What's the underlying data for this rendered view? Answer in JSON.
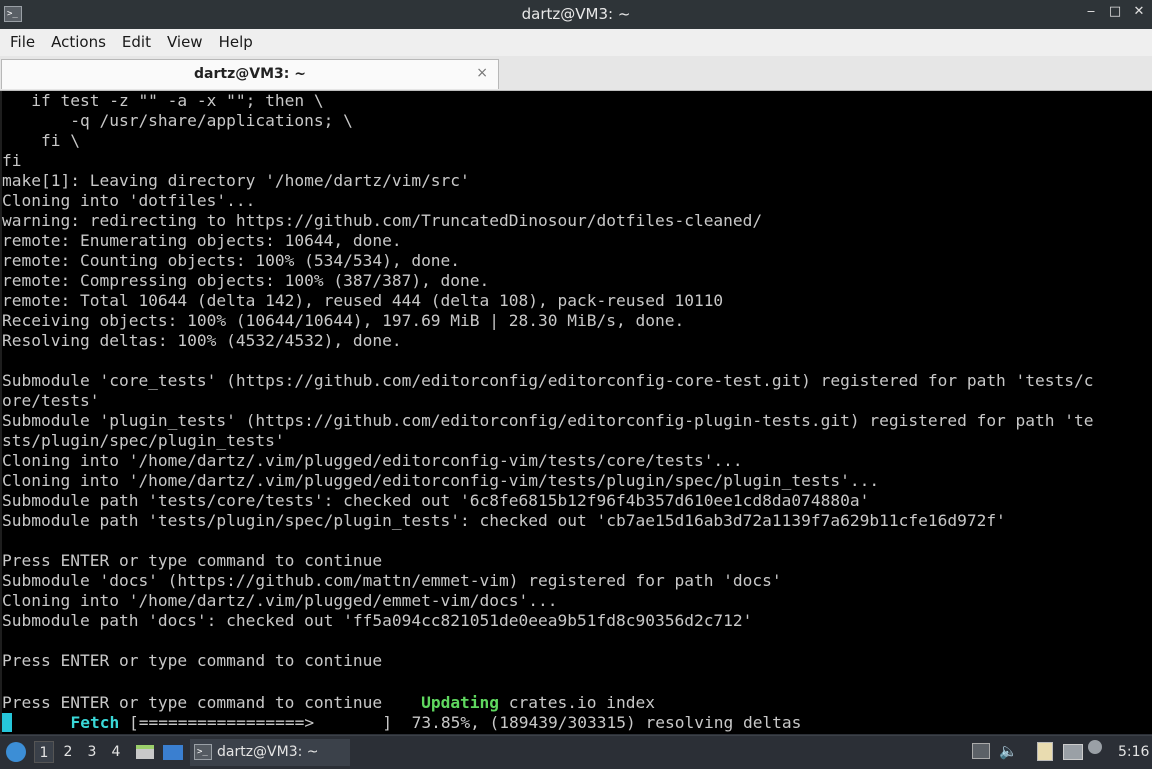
{
  "window": {
    "title": "dartz@VM3: ~",
    "icon_glyph": ">_",
    "controls": {
      "minimize": "‒",
      "maximize": "□",
      "close": "✕"
    }
  },
  "menu": [
    "File",
    "Actions",
    "Edit",
    "View",
    "Help"
  ],
  "tab": {
    "label": "dartz@VM3: ~",
    "close": "×"
  },
  "terminal": {
    "lines": [
      "   if test -z \"\" -a -x \"\"; then \\",
      "       -q /usr/share/applications; \\",
      "    fi \\",
      "fi",
      "make[1]: Leaving directory '/home/dartz/vim/src'",
      "Cloning into 'dotfiles'...",
      "warning: redirecting to https://github.com/TruncatedDinosour/dotfiles-cleaned/",
      "remote: Enumerating objects: 10644, done.",
      "remote: Counting objects: 100% (534/534), done.",
      "remote: Compressing objects: 100% (387/387), done.",
      "remote: Total 10644 (delta 142), reused 444 (delta 108), pack-reused 10110",
      "Receiving objects: 100% (10644/10644), 197.69 MiB | 28.30 MiB/s, done.",
      "Resolving deltas: 100% (4532/4532), done.",
      "",
      "Submodule 'core_tests' (https://github.com/editorconfig/editorconfig-core-test.git) registered for path 'tests/c",
      "ore/tests'",
      "Submodule 'plugin_tests' (https://github.com/editorconfig/editorconfig-plugin-tests.git) registered for path 'te",
      "sts/plugin/spec/plugin_tests'",
      "Cloning into '/home/dartz/.vim/plugged/editorconfig-vim/tests/core/tests'...",
      "Cloning into '/home/dartz/.vim/plugged/editorconfig-vim/tests/plugin/spec/plugin_tests'...",
      "Submodule path 'tests/core/tests': checked out '6c8fe6815b12f96f4b357d610ee1cd8da074880a'",
      "Submodule path 'tests/plugin/spec/plugin_tests': checked out 'cb7ae15d16ab3d72a1139f7a629b11cfe16d972f'",
      "",
      "Press ENTER or type command to continue",
      "Submodule 'docs' (https://github.com/mattn/emmet-vim) registered for path 'docs'",
      "Cloning into '/home/dartz/.vim/plugged/emmet-vim/docs'...",
      "Submodule path 'docs': checked out 'ff5a094cc821051de0eea9b51fd8c90356d2c712'",
      "",
      "Press ENTER or type command to continue",
      ""
    ],
    "press_line": {
      "prefix": "Press ENTER or type command to continue    ",
      "updating": "Updating",
      "suffix": " crates.io index"
    },
    "fetch_line": {
      "indent": "      ",
      "fetch": "Fetch",
      "rest": " [=================>       ]  73.85%, (189439/303315) resolving deltas"
    },
    "progress_percent": 73.85
  },
  "taskbar": {
    "workspaces": [
      "1",
      "2",
      "3",
      "4"
    ],
    "active_workspace": "1",
    "task_label": "dartz@VM3: ~",
    "clock": "5:16",
    "icons": [
      "start-menu-icon",
      "file-manager-icon",
      "show-desktop-icon",
      "monitor-icon",
      "volume-icon",
      "clipboard-icon",
      "network-icon",
      "notification-icon"
    ]
  }
}
